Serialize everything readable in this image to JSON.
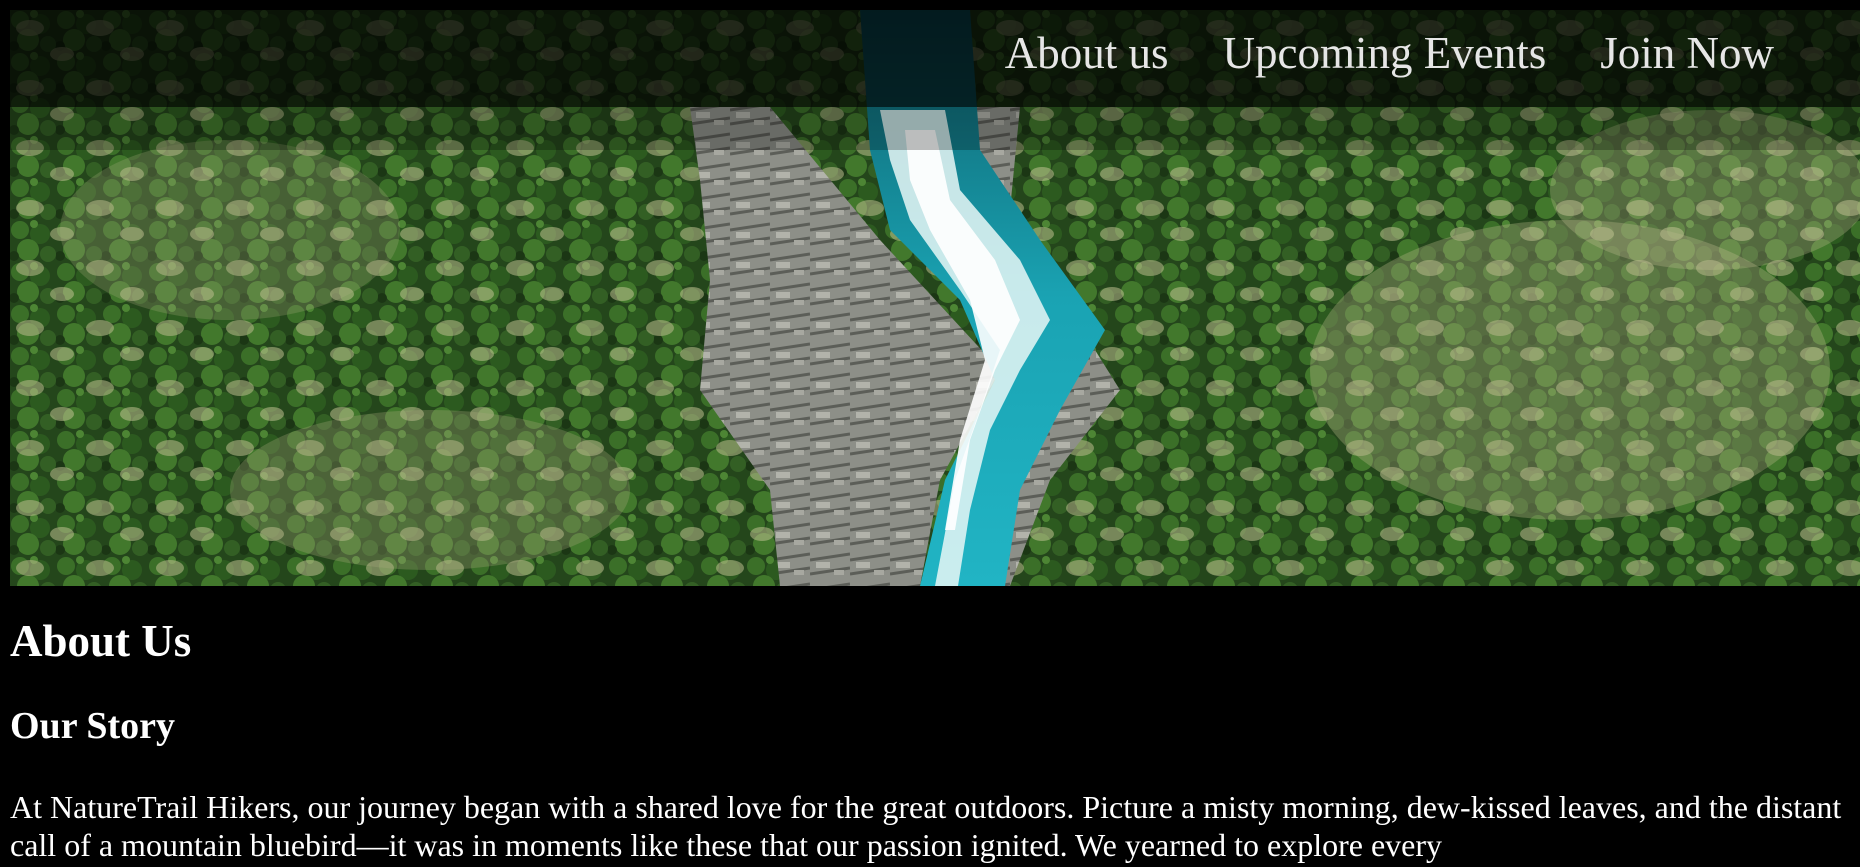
{
  "nav": {
    "links": [
      {
        "label": "About us"
      },
      {
        "label": "Upcoming Events"
      },
      {
        "label": "Join Now"
      }
    ]
  },
  "hero": {
    "image": "aerial-river-forest-photo"
  },
  "about": {
    "heading": "About Us",
    "subheading": "Our Story",
    "paragraph": "At NatureTrail Hikers, our journey began with a shared love for the great outdoors. Picture a misty morning, dew-kissed leaves, and the distant call of a mountain bluebird—it was in moments like these that our passion ignited. We yearned to explore every"
  },
  "colors": {
    "background": "#000000",
    "text": "#ffffff",
    "nav_text": "#e6e6e6",
    "river": "#1fa7b8",
    "forest": "#2f5a22"
  }
}
